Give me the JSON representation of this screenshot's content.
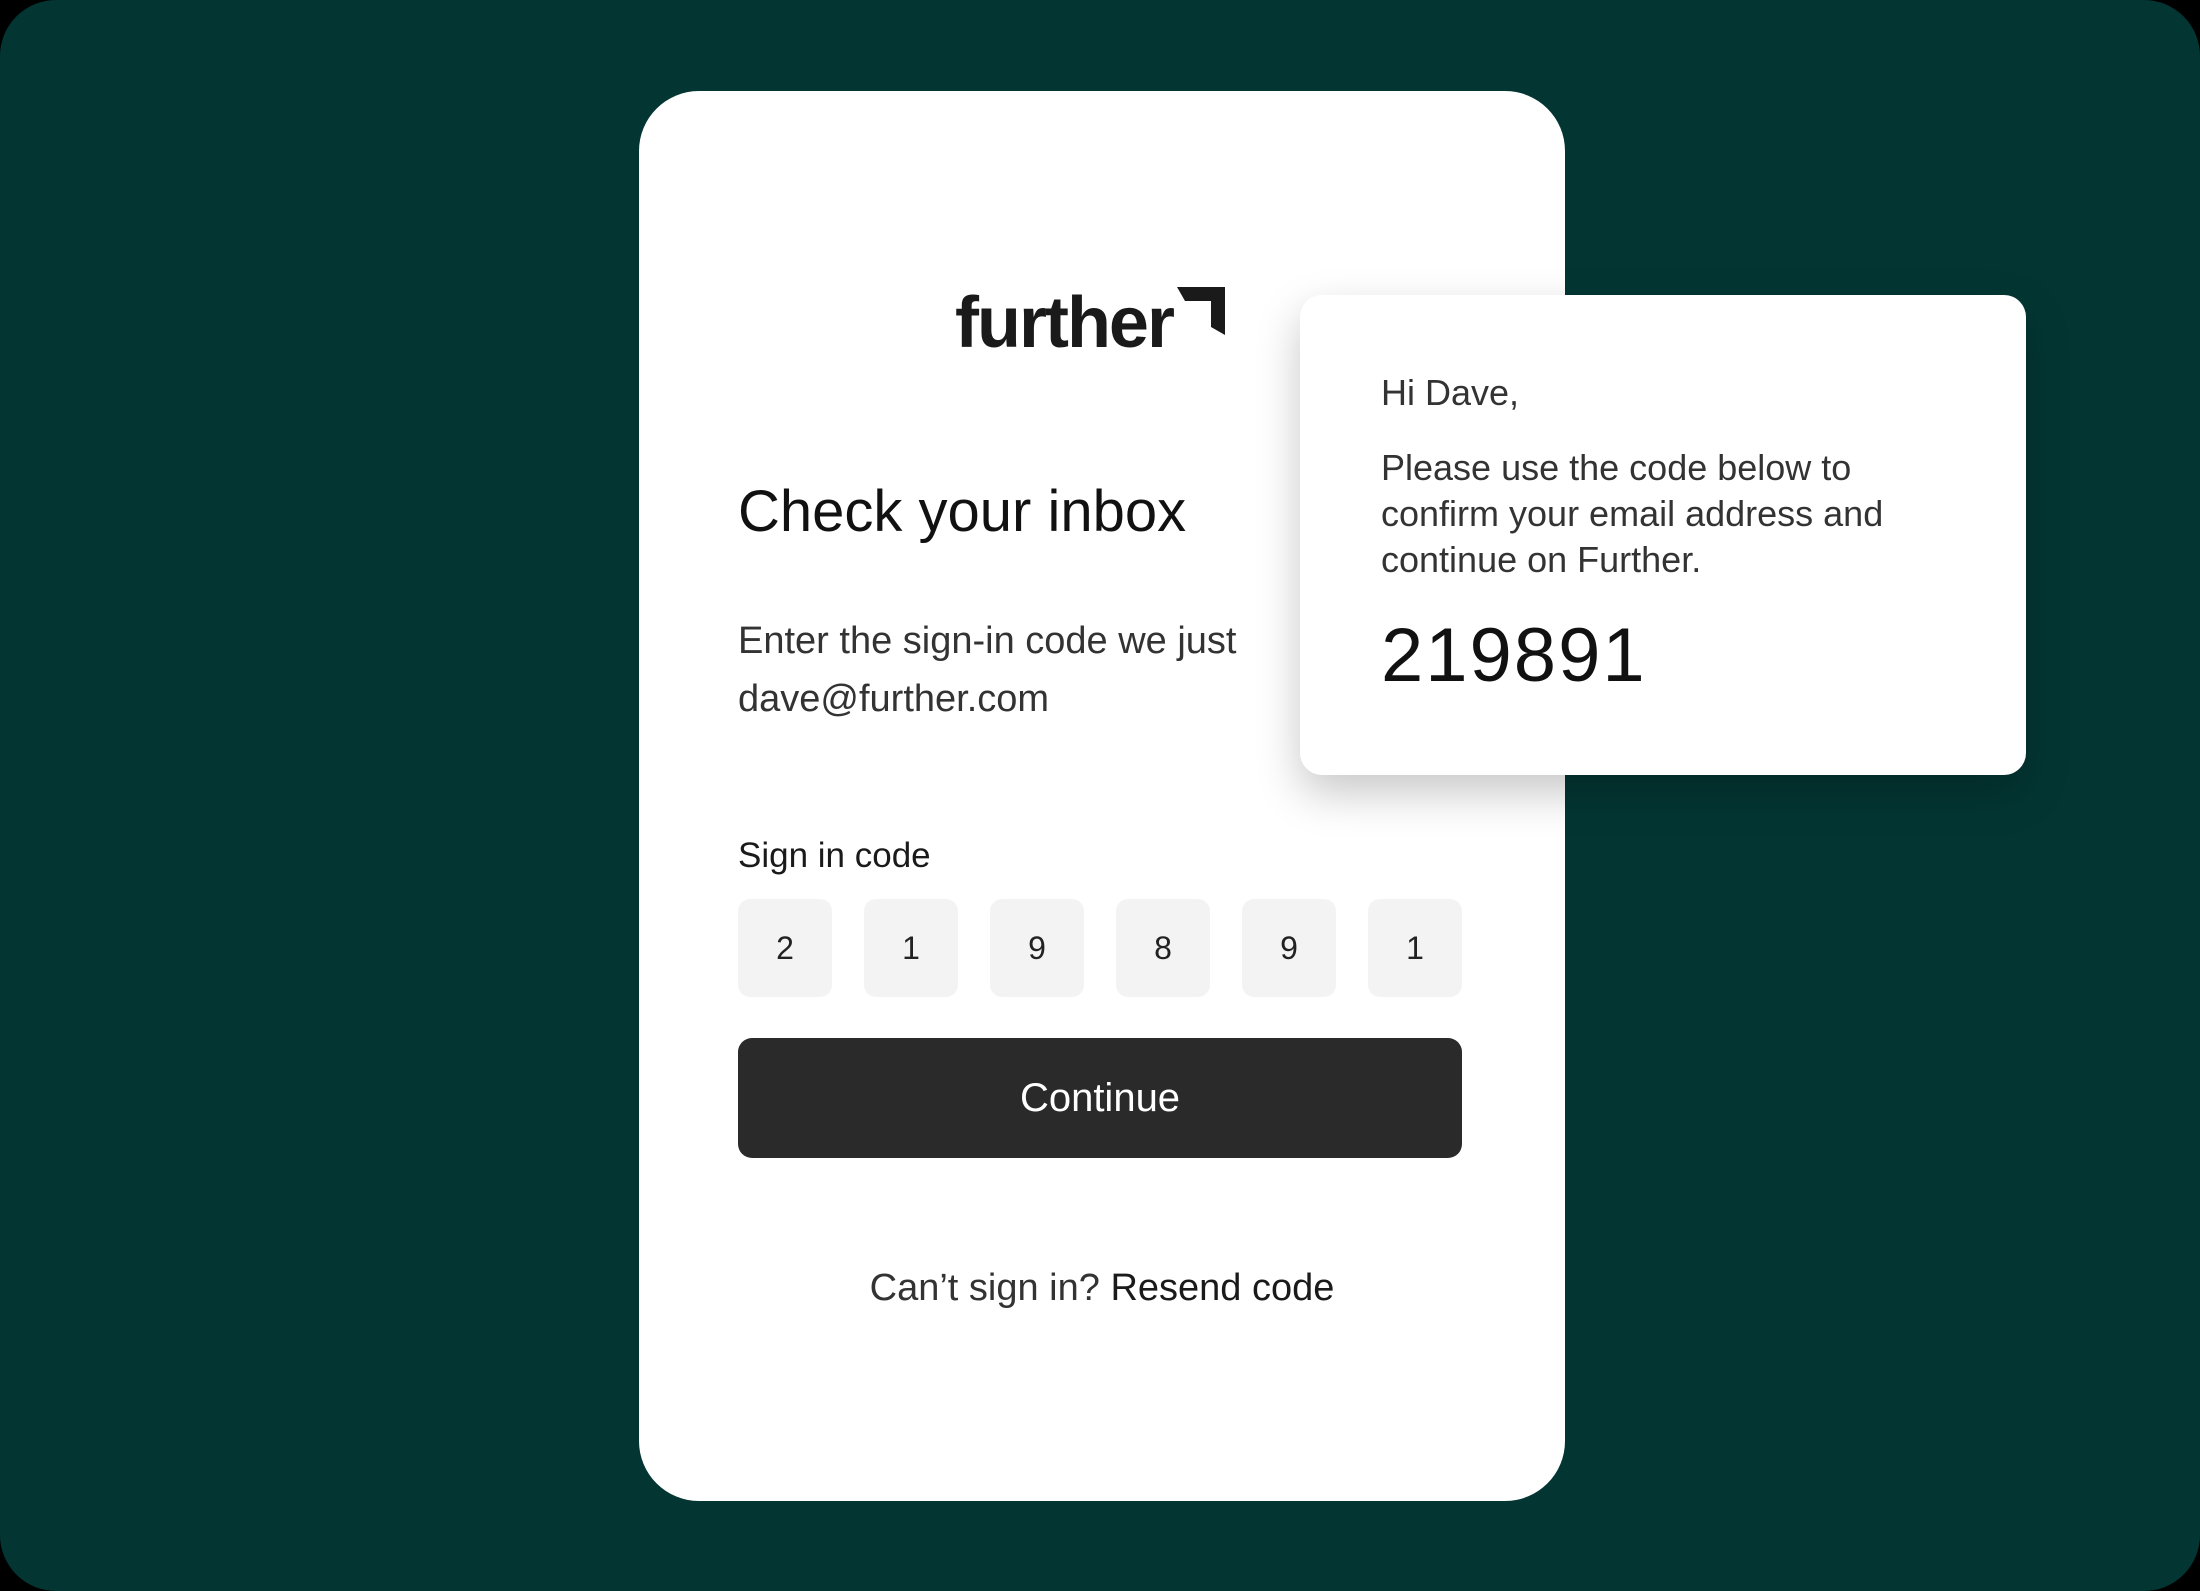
{
  "brand": {
    "logo_text": "further",
    "background_color": "#033633",
    "button_color": "#2a2a2a"
  },
  "signin": {
    "title": "Check your inbox",
    "description_line1": "Enter the sign-in code we just",
    "description_line2": "dave@further.com",
    "code_label": "Sign in code",
    "code_digits": [
      "2",
      "1",
      "9",
      "8",
      "9",
      "1"
    ],
    "continue_label": "Continue",
    "cant_sign_in": "Can’t sign in?",
    "resend_label": "Resend code"
  },
  "email": {
    "greeting": "Hi Dave,",
    "body_line1": "Please use the code below to",
    "body_line2": "confirm your email address and",
    "body_line3": "continue on Further.",
    "code": "219891"
  }
}
